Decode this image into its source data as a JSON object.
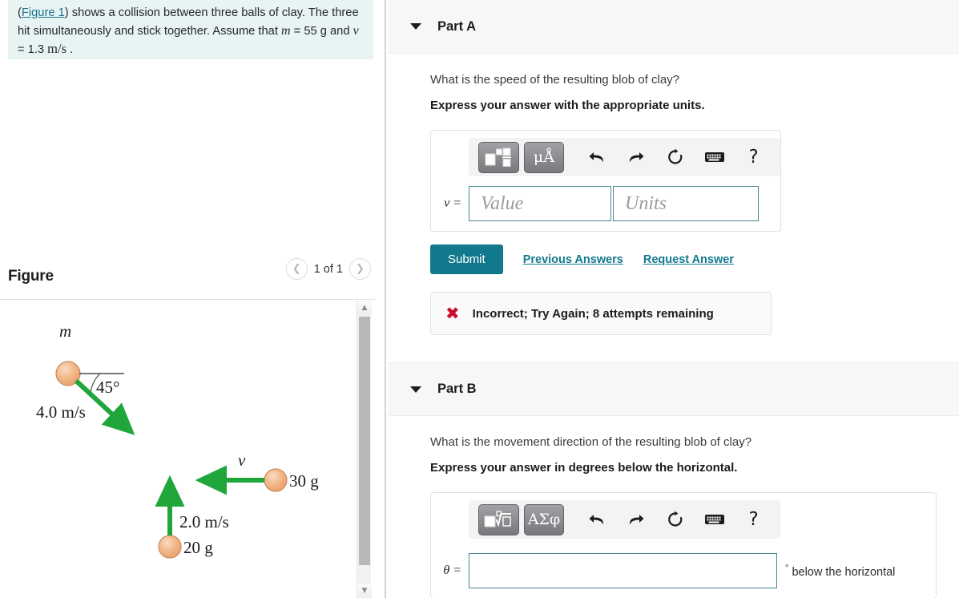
{
  "problem": {
    "figure_link": "Figure 1",
    "text_before": "(",
    "text_after": ") shows a collision between three balls of clay. The three hit simultaneously and stick together. Assume that ",
    "m_symbol": "m",
    "m_value": " = 55  g and ",
    "v_symbol": "v",
    "v_value": " = 1.3 ",
    "v_units": "m/s",
    "period": " ."
  },
  "figure": {
    "title": "Figure",
    "prev_icon": "chevron-left-icon",
    "next_icon": "chevron-right-icon",
    "counter": "1 of 1",
    "diagram": {
      "ball1_label": "m",
      "ball1_speed": "4.0 m/s",
      "ball1_angle": "45°",
      "ball2_label": "30 g",
      "ball2_speed_symbol": "v",
      "ball3_label": "20 g",
      "ball3_speed": "2.0 m/s",
      "ball_color": "#f2b183",
      "arrow_color": "#21a63c"
    }
  },
  "partA": {
    "caret_icon": "caret-down-icon",
    "label": "Part A",
    "question": "What is the speed of the resulting blob of clay?",
    "instruction": "Express your answer with the appropriate units.",
    "toolbar": {
      "template_icon": "math-template-icon",
      "units_label": "μÅ",
      "undo_icon": "undo-icon",
      "redo_icon": "redo-icon",
      "reset_icon": "reset-icon",
      "keyboard_icon": "keyboard-icon",
      "help_icon": "help-icon",
      "undo_glyph": "↶",
      "redo_glyph": "↷",
      "reset_glyph": "↻",
      "keyboard_glyph": "⌨",
      "help_glyph": "?"
    },
    "var_label": "v =",
    "value_placeholder": "Value",
    "units_placeholder": "Units",
    "submit_label": "Submit",
    "previous_answers_label": "Previous Answers",
    "request_answer_label": "Request Answer",
    "feedback": {
      "icon": "x-mark-icon",
      "glyph": "✖",
      "text": "Incorrect; Try Again; 8 attempts remaining",
      "color": "#cc0a2e"
    }
  },
  "partB": {
    "caret_icon": "caret-down-icon",
    "label": "Part B",
    "question": "What is the movement direction of the resulting blob of clay?",
    "instruction": "Express your answer in degrees below the horizontal.",
    "toolbar": {
      "template_icon": "math-root-template-icon",
      "greek_label": "ΑΣφ",
      "undo_glyph": "↶",
      "redo_glyph": "↷",
      "reset_glyph": "↻",
      "keyboard_glyph": "⌨",
      "help_glyph": "?"
    },
    "var_label": "θ =",
    "value": "",
    "suffix_degree": "°",
    "suffix_text": "below the horizontal"
  },
  "colors": {
    "accent": "#12798d",
    "info_bg": "#e8f4f3",
    "header_bg": "#f7f7f7",
    "field_border": "#4a8793"
  }
}
